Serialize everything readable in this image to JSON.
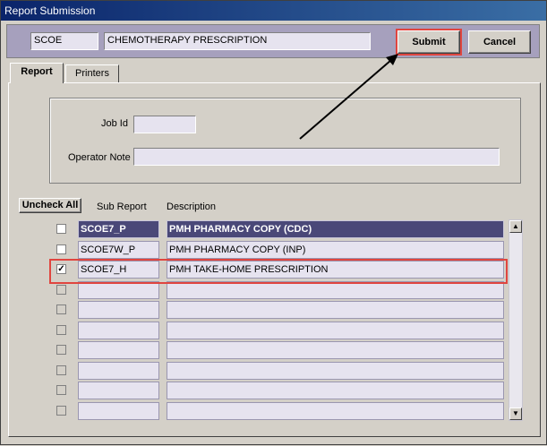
{
  "window": {
    "title": "Report Submission"
  },
  "header": {
    "code": "SCOE",
    "description": "CHEMOTHERAPY PRESCRIPTION",
    "submit_label": "Submit",
    "cancel_label": "Cancel"
  },
  "tabs": [
    {
      "label": "Report",
      "active": true
    },
    {
      "label": "Printers",
      "active": false
    }
  ],
  "form": {
    "job_id_label": "Job Id",
    "job_id_value": "",
    "operator_note_label": "Operator Note",
    "operator_note_value": ""
  },
  "grid": {
    "uncheck_all_label": "Uncheck All",
    "col_sub_report": "Sub Report",
    "col_description": "Description",
    "rows": [
      {
        "checked": false,
        "enabled": true,
        "sub_report": "SCOE7_P",
        "description": "PMH PHARMACY COPY (CDC)",
        "selected": true
      },
      {
        "checked": false,
        "enabled": true,
        "sub_report": "SCOE7W_P",
        "description": "PMH PHARMACY COPY (INP)",
        "selected": false
      },
      {
        "checked": true,
        "enabled": true,
        "sub_report": "SCOE7_H",
        "description": "PMH TAKE-HOME PRESCRIPTION",
        "selected": false
      },
      {
        "checked": false,
        "enabled": false,
        "sub_report": "",
        "description": "",
        "selected": false
      },
      {
        "checked": false,
        "enabled": false,
        "sub_report": "",
        "description": "",
        "selected": false
      },
      {
        "checked": false,
        "enabled": false,
        "sub_report": "",
        "description": "",
        "selected": false
      },
      {
        "checked": false,
        "enabled": false,
        "sub_report": "",
        "description": "",
        "selected": false
      },
      {
        "checked": false,
        "enabled": false,
        "sub_report": "",
        "description": "",
        "selected": false
      },
      {
        "checked": false,
        "enabled": false,
        "sub_report": "",
        "description": "",
        "selected": false
      },
      {
        "checked": false,
        "enabled": false,
        "sub_report": "",
        "description": "",
        "selected": false
      }
    ]
  },
  "icons": {
    "scroll_up": "scroll-up-arrow-icon",
    "scroll_down": "scroll-down-arrow-icon",
    "annotation_arrow": "annotation-arrow-icon"
  },
  "colors": {
    "annotation": "#e0453f",
    "selected_row": "#4a4878"
  }
}
